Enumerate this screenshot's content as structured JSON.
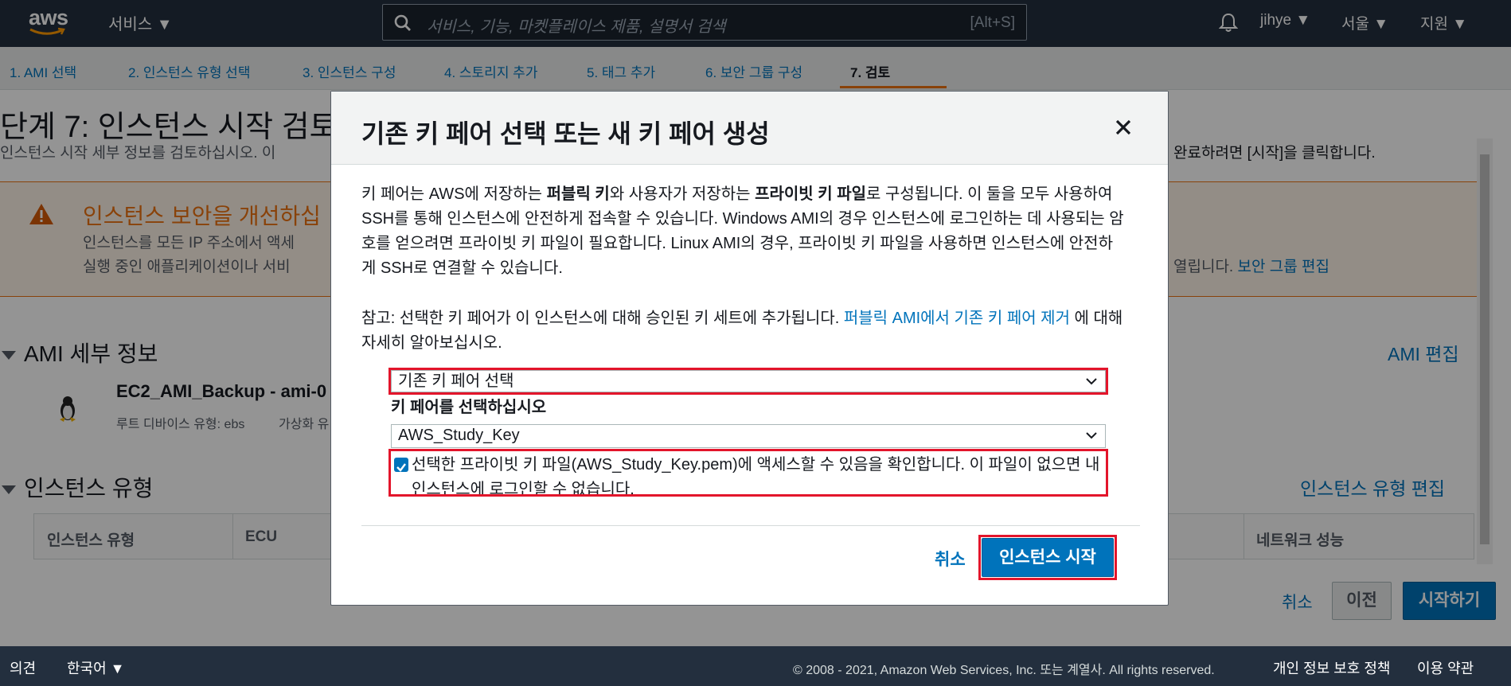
{
  "topnav": {
    "logo_text": "aws",
    "services_label": "서비스 ▼",
    "search_placeholder": "서비스, 기능, 마켓플레이스 제품, 설명서 검색",
    "search_shortcut": "[Alt+S]",
    "user": "jihye ▼",
    "region": "서울 ▼",
    "support": "지원 ▼"
  },
  "steps": [
    {
      "label": "1. AMI 선택"
    },
    {
      "label": "2. 인스턴스 유형 선택"
    },
    {
      "label": "3. 인스턴스 구성"
    },
    {
      "label": "4. 스토리지 추가"
    },
    {
      "label": "5. 태그 추가"
    },
    {
      "label": "6. 보안 그룹 구성"
    },
    {
      "label": "7. 검토"
    }
  ],
  "page": {
    "title": "단계 7: 인스턴스 시작 검토",
    "subtitle": "인스턴스 시작 세부 정보를 검토하십시오. 이",
    "subtitle_right": "완료하려면 [시작]을 클릭합니다.",
    "warning": {
      "title": "인스턴스 보안을 개선하십",
      "line1": "인스턴스를 모든 IP 주소에서 액세",
      "line2": "실행 중인 애플리케이션이나 서비",
      "right_text": "열립니다.",
      "right_link": "보안 그룹 편집"
    },
    "ami_section": {
      "title": "AMI 세부 정보",
      "edit": "AMI 편집",
      "ami_name": "EC2_AMI_Backup - ami-0",
      "root_device": "루트 디바이스 유형: ebs",
      "virtualization": "가상화 유"
    },
    "instance_section": {
      "title": "인스턴스 유형",
      "edit": "인스턴스 유형 편집"
    },
    "table_headers": [
      "인스턴스 유형",
      "ECU",
      "네트워크 성능"
    ],
    "buttons": {
      "cancel": "취소",
      "prev": "이전",
      "launch": "시작하기"
    }
  },
  "modal": {
    "title": "기존 키 페어 선택 또는 새 키 페어 생성",
    "body_1": "키 페어는 AWS에 저장하는 ",
    "body_bold_1": "퍼블릭 키",
    "body_2": "와 사용자가 저장하는 ",
    "body_bold_2": "프라이빗 키 파일",
    "body_3": "로 구성됩니다. 이 둘을 모두 사용하여 SSH를 통해 인스턴스에 안전하게 접속할 수 있습니다. Windows AMI의 경우 인스턴스에 로그인하는 데 사용되는 암호를 얻으려면 프라이빗 키 파일이 필요합니다. Linux AMI의 경우, 프라이빗 키 파일을 사용하면 인스턴스에 안전하게 SSH로 연결할 수 있습니다.",
    "note_1": "참고: 선택한 키 페어가 이 인스턴스에 대해 승인된 키 세트에 추가됩니다. ",
    "note_link": "퍼블릭 AMI에서 기존 키 페어 제거",
    "note_2": " 에 대해 자세히 알아보십시오.",
    "keypair_mode": "기존 키 페어 선택",
    "select_label": "키 페어를 선택하십시오",
    "selected_key": "AWS_Study_Key",
    "ack_text": "선택한 프라이빗 키 파일(AWS_Study_Key.pem)에 액세스할 수 있음을 확인합니다. 이 파일이 없으면 내 인스턴스에 로그인할 수 없습니다.",
    "ack_checked": true,
    "cancel": "취소",
    "launch": "인스턴스 시작"
  },
  "footer": {
    "feedback": "의견",
    "language": "한국어 ▼",
    "copyright": "© 2008 - 2021, Amazon Web Services, Inc. 또는 계열사. All rights reserved.",
    "privacy": "개인 정보 보호 정책",
    "terms": "이용 약관"
  },
  "colors": {
    "nav": "#232f3e",
    "link": "#0073bb",
    "accent": "#ec7211",
    "highlight": "#e3152b"
  }
}
